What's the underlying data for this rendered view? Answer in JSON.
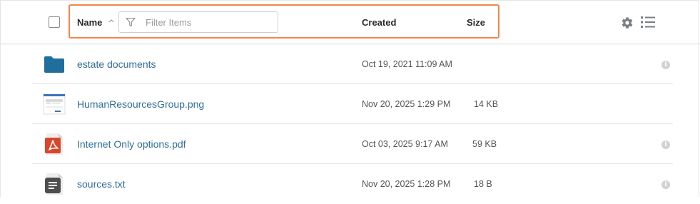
{
  "header": {
    "name_label": "Name",
    "filter_placeholder": "Filter Items",
    "created_label": "Created",
    "size_label": "Size",
    "sort_direction": "ascending",
    "icons": {
      "sort": "chevron-up-icon",
      "filter": "filter-funnel-icon",
      "settings": "gear-icon",
      "view": "list-view-icon"
    }
  },
  "rows": [
    {
      "name": "estate documents",
      "created": "Oct 19, 2021 11:09 AM",
      "size": "",
      "icon": "folder-icon",
      "info": true
    },
    {
      "name": "HumanResourcesGroup.png",
      "created": "Nov 20, 2025 1:29 PM",
      "size": "14 KB",
      "icon": "image-thumbnail-icon",
      "info": false
    },
    {
      "name": "Internet Only options.pdf",
      "created": "Oct 03, 2025 9:17 AM",
      "size": "59 KB",
      "icon": "pdf-file-icon",
      "info": true
    },
    {
      "name": "sources.txt",
      "created": "Nov 20, 2025 1:28 PM",
      "size": "18 B",
      "icon": "text-file-icon",
      "info": true
    }
  ],
  "colors": {
    "highlight": "#f0874a",
    "link": "#2f6f9a",
    "folder": "#1f6e9e",
    "pdf": "#d9462b"
  }
}
